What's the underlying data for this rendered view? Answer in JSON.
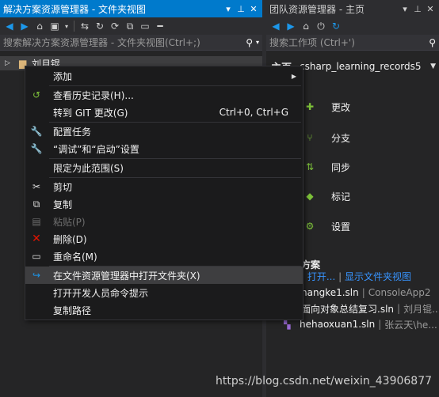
{
  "left_panel": {
    "title": "解决方案资源管理器 - 文件夹视图",
    "search_placeholder": "搜索解决方案资源管理器 - 文件夹视图(Ctrl+;)",
    "tree_root_label": "刘月锟"
  },
  "right_panel": {
    "title": "团队资源管理器 - 主页",
    "search_placeholder": "搜索工作项 (Ctrl+')",
    "section": "主页",
    "repo": "csharp_learning_records5",
    "actions": [
      {
        "label": "更改",
        "icon": "changes-icon"
      },
      {
        "label": "分支",
        "icon": "branch-icon"
      },
      {
        "label": "同步",
        "icon": "sync-icon"
      },
      {
        "label": "标记",
        "icon": "tag-icon"
      },
      {
        "label": "设置",
        "icon": "settings-icon"
      }
    ],
    "solutions_title": "方案",
    "solutions_links": {
      "open": "打开...",
      "show_folder": "显示文件夹视图"
    },
    "solutions": [
      {
        "name": "hangke1.sln",
        "project": "ConsoleApp2"
      },
      {
        "name": "面向对象总结复习.sln",
        "project": "刘月锟..."
      },
      {
        "name": "hehaoxuan1.sln",
        "project": "张云天\\he..."
      }
    ]
  },
  "context_menu": {
    "items": [
      {
        "label": "添加",
        "shortcut": "",
        "submenu": true,
        "icon": ""
      },
      {
        "label": "查看历史记录(H)...",
        "shortcut": "",
        "icon": "history-icon"
      },
      {
        "label": "转到 GIT 更改(G)",
        "shortcut": "Ctrl+0, Ctrl+G",
        "icon": ""
      },
      {
        "label": "配置任务",
        "shortcut": "",
        "icon": "wrench-icon"
      },
      {
        "label": "“调试”和“启动”设置",
        "shortcut": "",
        "icon": "wrench-icon"
      },
      {
        "label": "限定为此范围(S)",
        "shortcut": "",
        "icon": ""
      },
      {
        "label": "剪切",
        "shortcut": "",
        "icon": "cut-icon"
      },
      {
        "label": "复制",
        "shortcut": "",
        "icon": "copy-icon"
      },
      {
        "label": "粘贴(P)",
        "shortcut": "",
        "icon": "paste-icon",
        "disabled": true
      },
      {
        "label": "删除(D)",
        "shortcut": "",
        "icon": "delete-icon"
      },
      {
        "label": "重命名(M)",
        "shortcut": "",
        "icon": "rename-icon"
      },
      {
        "label": "在文件资源管理器中打开文件夹(X)",
        "shortcut": "",
        "icon": "open-folder-icon",
        "highlighted": true
      },
      {
        "label": "打开开发人员命令提示",
        "shortcut": "",
        "icon": ""
      },
      {
        "label": "复制路径",
        "shortcut": "",
        "icon": ""
      }
    ]
  },
  "watermark": "https://blog.csdn.net/weixin_43906877",
  "colors": {
    "accent": "#007acc",
    "background": "#252526",
    "menu": "#1b1b1c",
    "delete": "#e51400",
    "history": "#7ec23a"
  }
}
